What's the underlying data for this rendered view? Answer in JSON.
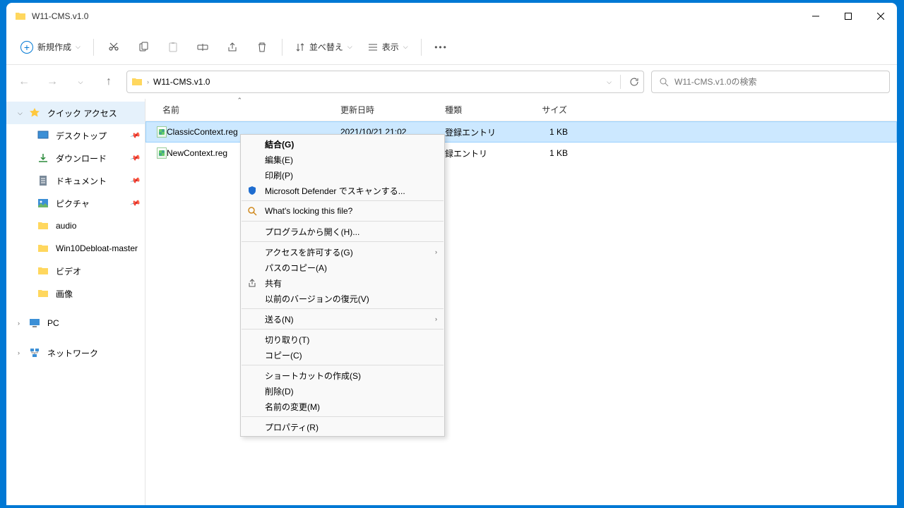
{
  "titlebar": {
    "title": "W11-CMS.v1.0"
  },
  "toolbar": {
    "new_label": "新規作成",
    "sort_label": "並べ替え",
    "view_label": "表示"
  },
  "address": {
    "crumb": "W11-CMS.v1.0"
  },
  "search": {
    "placeholder": "W11-CMS.v1.0の検索"
  },
  "sidebar": {
    "quick_access": "クイック アクセス",
    "items": [
      {
        "label": "デスクトップ",
        "pinned": true
      },
      {
        "label": "ダウンロード",
        "pinned": true
      },
      {
        "label": "ドキュメント",
        "pinned": true
      },
      {
        "label": "ピクチャ",
        "pinned": true
      },
      {
        "label": "audio",
        "pinned": false
      },
      {
        "label": "Win10Debloat-master",
        "pinned": false
      },
      {
        "label": "ビデオ",
        "pinned": false
      },
      {
        "label": "画像",
        "pinned": false
      }
    ],
    "pc": "PC",
    "network": "ネットワーク"
  },
  "columns": {
    "name": "名前",
    "date": "更新日時",
    "type": "種類",
    "size": "サイズ"
  },
  "files": [
    {
      "name": "ClassicContext.reg",
      "date": "2021/10/21 21:02",
      "type": "登録エントリ",
      "size": "1 KB",
      "selected": true
    },
    {
      "name": "NewContext.reg",
      "date": "",
      "type": "録エントリ",
      "size": "1 KB",
      "selected": false
    }
  ],
  "context_menu": {
    "items": [
      {
        "label": "結合(G)",
        "bold": true
      },
      {
        "label": "編集(E)"
      },
      {
        "label": "印刷(P)"
      },
      {
        "label": "Microsoft Defender でスキャンする...",
        "icon": "shield"
      },
      {
        "sep": true
      },
      {
        "label": "What's locking this file?",
        "icon": "lock"
      },
      {
        "sep": true
      },
      {
        "label": "プログラムから開く(H)..."
      },
      {
        "sep": true
      },
      {
        "label": "アクセスを許可する(G)",
        "submenu": true
      },
      {
        "label": "パスのコピー(A)"
      },
      {
        "label": "共有",
        "icon": "share"
      },
      {
        "label": "以前のバージョンの復元(V)"
      },
      {
        "sep": true
      },
      {
        "label": "送る(N)",
        "submenu": true
      },
      {
        "sep": true
      },
      {
        "label": "切り取り(T)"
      },
      {
        "label": "コピー(C)"
      },
      {
        "sep": true
      },
      {
        "label": "ショートカットの作成(S)"
      },
      {
        "label": "削除(D)"
      },
      {
        "label": "名前の変更(M)"
      },
      {
        "sep": true
      },
      {
        "label": "プロパティ(R)"
      }
    ]
  }
}
